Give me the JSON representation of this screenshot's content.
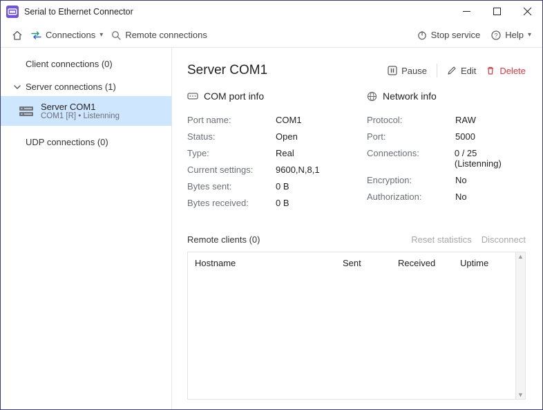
{
  "window": {
    "title": "Serial to Ethernet Connector"
  },
  "toolbar": {
    "connections": "Connections",
    "remote": "Remote connections",
    "stop_service": "Stop service",
    "help": "Help"
  },
  "sidebar": {
    "client_label": "Client connections (0)",
    "server_label": "Server connections (1)",
    "udp_label": "UDP connections (0)",
    "server_items": [
      {
        "name": "Server COM1",
        "sub": "COM1 [R] • Listenning"
      }
    ]
  },
  "main": {
    "title": "Server COM1",
    "actions": {
      "pause": "Pause",
      "edit": "Edit",
      "delete": "Delete"
    },
    "com_info": {
      "heading": "COM port info",
      "rows": [
        {
          "k": "Port name:",
          "v": "COM1"
        },
        {
          "k": "Status:",
          "v": "Open"
        },
        {
          "k": "Type:",
          "v": "Real"
        },
        {
          "k": "Current settings:",
          "v": "9600,N,8,1"
        },
        {
          "k": "Bytes sent:",
          "v": "0 B"
        },
        {
          "k": "Bytes received:",
          "v": "0 B"
        }
      ]
    },
    "net_info": {
      "heading": "Network info",
      "rows": [
        {
          "k": "Protocol:",
          "v": "RAW"
        },
        {
          "k": "Port:",
          "v": "5000"
        },
        {
          "k": "Connections:",
          "v": "0 / 25 (Listenning)"
        },
        {
          "k": "Encryption:",
          "v": "No"
        },
        {
          "k": "Authorization:",
          "v": "No"
        }
      ]
    },
    "remote": {
      "title": "Remote clients (0)",
      "reset": "Reset statistics",
      "disconnect": "Disconnect",
      "cols": {
        "host": "Hostname",
        "sent": "Sent",
        "recv": "Received",
        "uptime": "Uptime"
      }
    }
  }
}
